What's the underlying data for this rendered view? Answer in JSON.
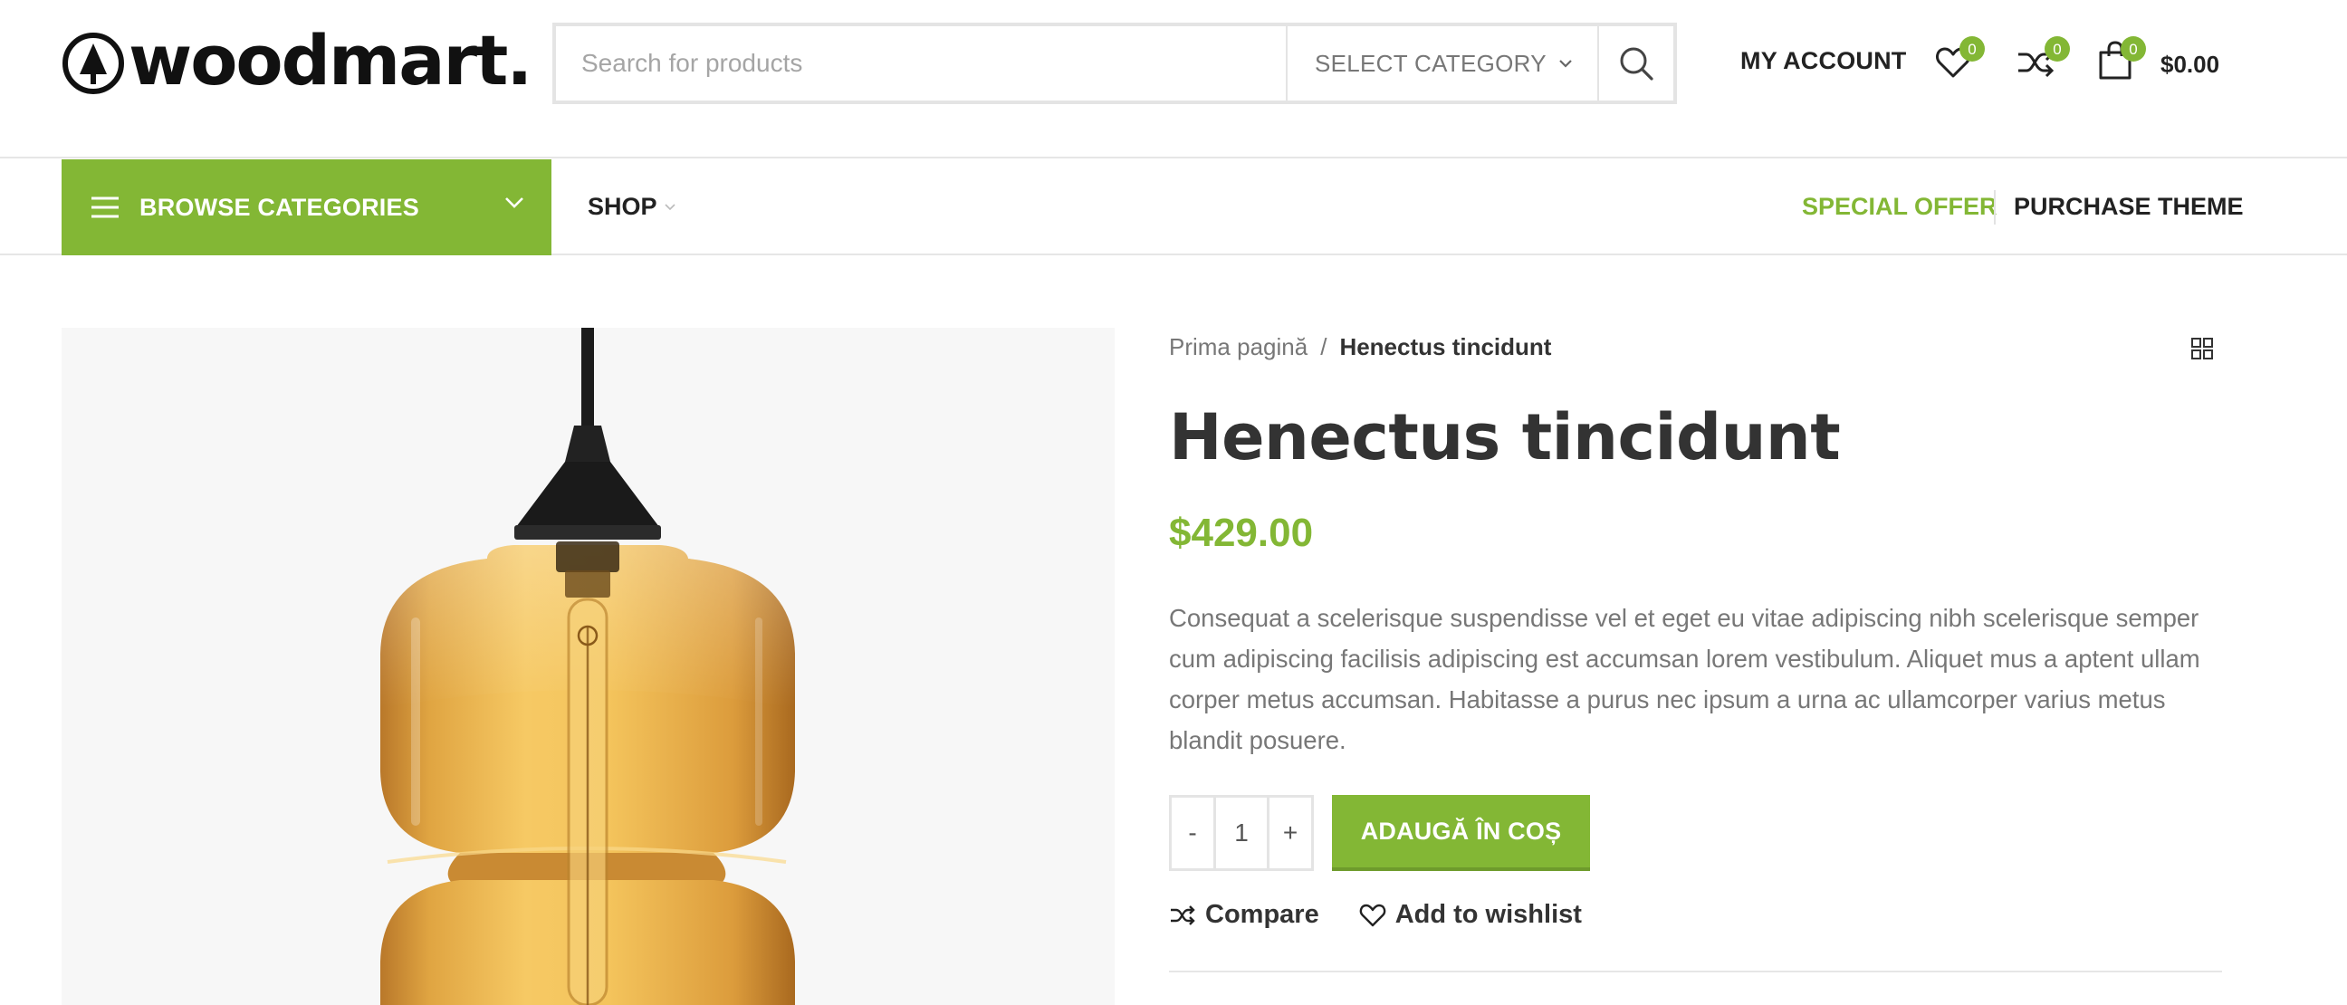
{
  "logo": {
    "text": "woodmart."
  },
  "search": {
    "placeholder": "Search for products",
    "category_label": "SELECT CATEGORY"
  },
  "header": {
    "account_label": "MY ACCOUNT",
    "wishlist_count": "0",
    "compare_count": "0",
    "cart_count": "0",
    "cart_total": "$0.00"
  },
  "nav": {
    "browse_label": "BROWSE CATEGORIES",
    "shop_label": "SHOP",
    "special_offer_label": "SPECIAL OFFER",
    "purchase_theme_label": "PURCHASE THEME"
  },
  "breadcrumb": {
    "home": "Prima pagină",
    "separator": "/",
    "current": "Henectus tincidunt"
  },
  "product": {
    "title": "Henectus tincidunt",
    "price": "$429.00",
    "description": "Consequat a scelerisque suspendisse vel et eget eu vitae adipiscing nibh scelerisque semper cum adipiscing facilisis adipiscing est accumsan lorem vestibulum. Aliquet mus a aptent ullam corper metus accumsan. Habitasse a purus nec ipsum a urna ac ullamcorper varius metus blandit posuere.",
    "quantity": "1",
    "qty_minus": "-",
    "qty_plus": "+",
    "add_to_cart_label": "ADAUGĂ ÎN COȘ",
    "compare_label": "Compare",
    "wishlist_label": "Add to wishlist",
    "image_icon": "amber-glass-pendant-lamp"
  },
  "colors": {
    "accent": "#83b735",
    "text": "#333333",
    "muted": "#777777",
    "border": "#e4e4e4"
  }
}
